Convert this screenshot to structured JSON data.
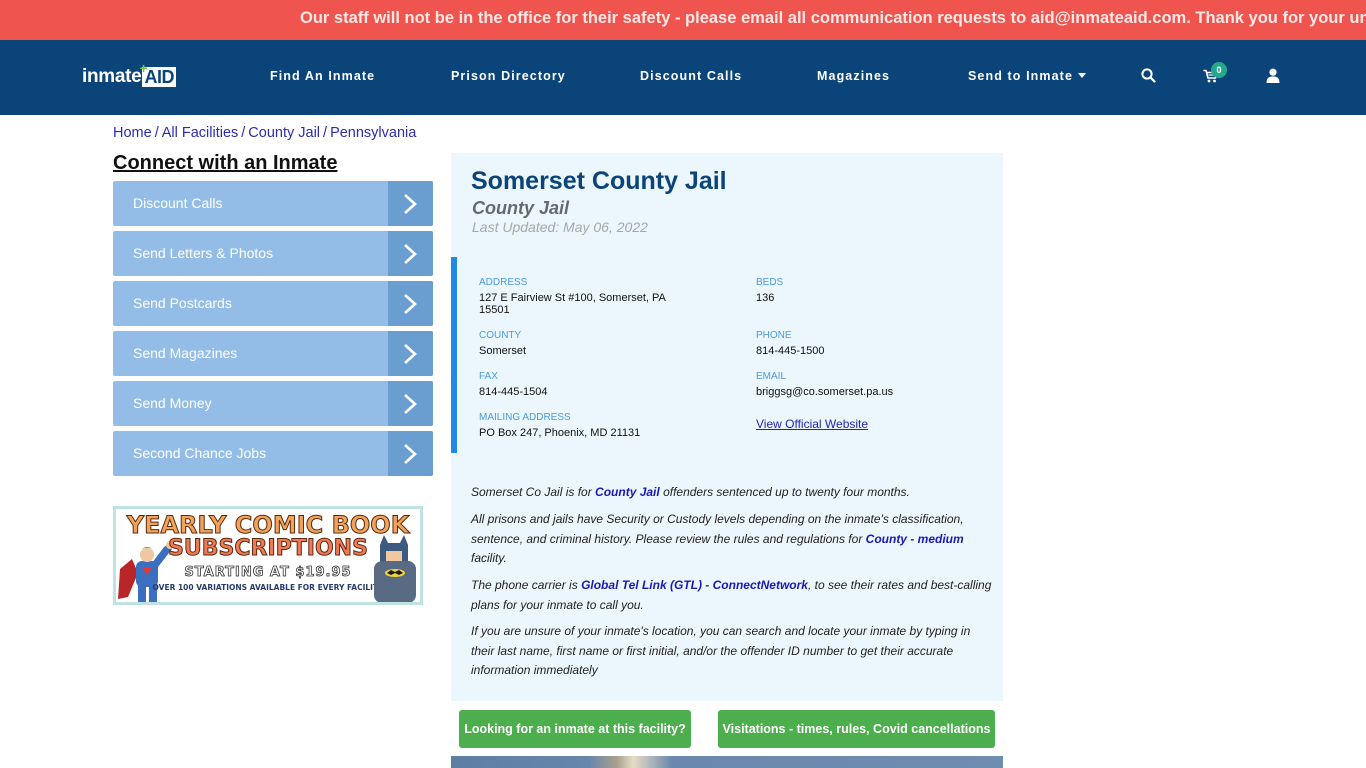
{
  "alert": {
    "text": "Our staff will not be in the office for their safety - please email all communication requests to aid@inmateaid.com. Thank you for your understanding."
  },
  "brand": {
    "logo_prefix": "inmate",
    "logo_suffix": "AID"
  },
  "nav": {
    "items": [
      {
        "label": "Find An Inmate"
      },
      {
        "label": "Prison Directory"
      },
      {
        "label": "Discount Calls"
      },
      {
        "label": "Magazines"
      },
      {
        "label": "Send to Inmate",
        "has_dropdown": true
      }
    ],
    "icons": [
      "search-icon",
      "cart-icon",
      "user-icon"
    ],
    "cart_count": "0"
  },
  "breadcrumb": [
    {
      "label": "Home"
    },
    {
      "label": "All Facilities"
    },
    {
      "label": "County Jail"
    },
    {
      "label": "Pennsylvania"
    }
  ],
  "breadcrumb_separator": "/",
  "sidebar": {
    "title": "Connect with an Inmate",
    "buttons": [
      {
        "label": "Discount Calls"
      },
      {
        "label": "Send Letters & Photos"
      },
      {
        "label": "Send Postcards"
      },
      {
        "label": "Send Magazines"
      },
      {
        "label": "Send Money"
      },
      {
        "label": "Second Chance Jobs"
      }
    ],
    "ad": {
      "line1": "YEARLY COMIC BOOK",
      "line2": "SUBSCRIPTIONS",
      "line3": "STARTING AT $19.95",
      "line4": "OVER 100 VARIATIONS AVAILABLE FOR EVERY FACILITY"
    }
  },
  "facility": {
    "name": "Somerset County Jail",
    "type": "County Jail",
    "last_updated": "Last Updated: May 06, 2022",
    "fields": {
      "address": {
        "label": "ADDRESS",
        "value": "127 E Fairview St #100, Somerset, PA 15501"
      },
      "beds": {
        "label": "BEDS",
        "value": "136"
      },
      "county": {
        "label": "COUNTY",
        "value": "Somerset"
      },
      "phone": {
        "label": "PHONE",
        "value": "814-445-1500"
      },
      "fax": {
        "label": "FAX",
        "value": "814-445-1504"
      },
      "email": {
        "label": "EMAIL",
        "value": "briggsg@co.somerset.pa.us"
      },
      "mailing_address": {
        "label": "MAILING ADDRESS",
        "value": "PO Box 247, Phoenix, MD 21131"
      }
    },
    "website_link": "View Official Website"
  },
  "description": {
    "p1_before": "Somerset Co Jail is for ",
    "p1_link": "County Jail",
    "p1_after": " offenders sentenced up to twenty four months.",
    "p2_before": "All prisons and jails have Security or Custody levels depending on the inmate's classification, sentence, and criminal history. Please review the rules and regulations for ",
    "p2_link": "County - medium",
    "p2_after": " facility.",
    "p3_before": "The phone carrier is ",
    "p3_link": "Global Tel Link (GTL) - ConnectNetwork",
    "p3_after": ", to see their rates and best-calling plans for your inmate to call you.",
    "p4": "If you are unsure of your inmate's location, you can search and locate your inmate by typing in their last name, first name or first initial, and/or the offender ID number to get their accurate information immediately"
  },
  "actions": {
    "find_inmate": "Looking for an inmate at this facility?",
    "visitations": "Visitations - times, rules, Covid cancellations"
  },
  "colors": {
    "alert_bg": "#f0544f",
    "nav_bg": "#0b4479",
    "sidebar_btn": "#93bde6",
    "sidebar_arrow": "#6a9ed1",
    "panel_bg": "#ecf6fd",
    "accent_border": "#1e8ae6",
    "green_btn": "#4cae4c",
    "badge": "#26a98b"
  }
}
